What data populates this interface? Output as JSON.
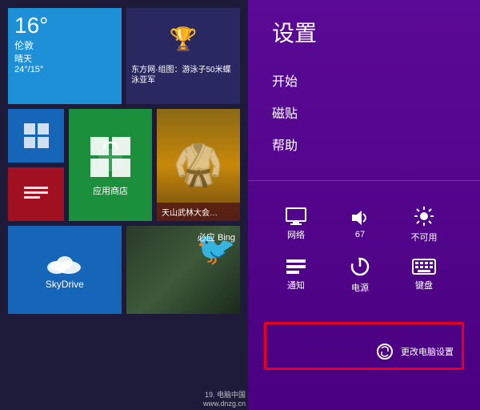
{
  "left_panel": {
    "tiles": {
      "weather": {
        "temperature": "16°",
        "city": "伦敦",
        "condition": "晴天",
        "range": "24°/15°"
      },
      "news": {
        "text": "东方网·组图：游泳子50米蝶泳亚军"
      },
      "store": {
        "label": "应用商店"
      },
      "martial": {
        "text": "天山武林大会…"
      },
      "skydrive": {
        "label": "SkyDrive"
      },
      "bing": {
        "label": "必应 Bing"
      }
    }
  },
  "right_panel": {
    "title": "设置",
    "menu": [
      {
        "label": "开始"
      },
      {
        "label": "磁贴"
      },
      {
        "label": "帮助"
      }
    ],
    "quick_settings": {
      "row1": [
        {
          "icon": "monitor",
          "label": "网络",
          "symbol": "🖥"
        },
        {
          "icon": "volume",
          "label": "67",
          "symbol": "🔈"
        },
        {
          "icon": "brightness",
          "label": "不可用",
          "symbol": "☀"
        }
      ],
      "row2": [
        {
          "icon": "notification",
          "label": "通知",
          "symbol": "☰"
        },
        {
          "icon": "power",
          "label": "电源",
          "symbol": "⏻"
        },
        {
          "icon": "keyboard",
          "label": "键盘",
          "symbol": "⌨"
        }
      ]
    },
    "bottom_button": "更改电脑设置"
  },
  "watermark": {
    "line1": "19. 电脑中国",
    "line2": "www.dnzg.cn"
  }
}
